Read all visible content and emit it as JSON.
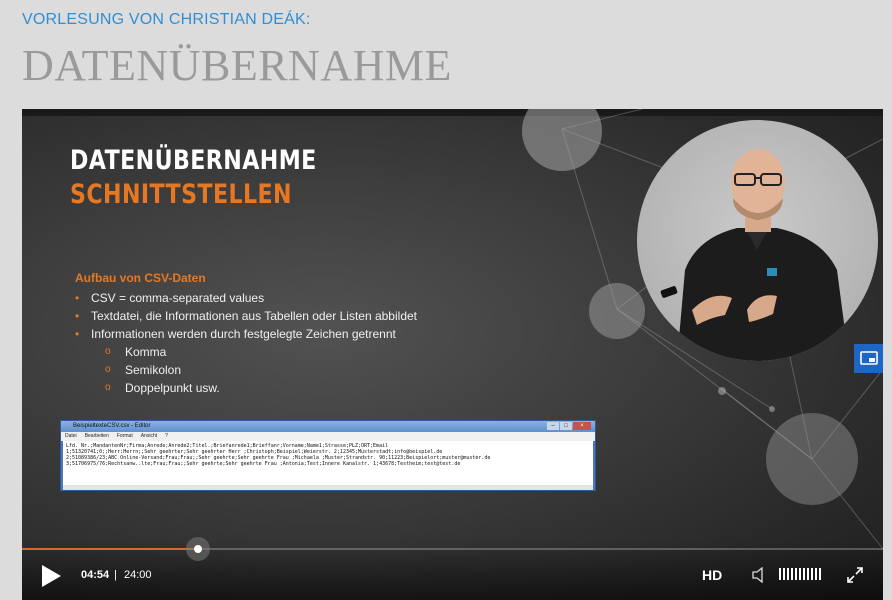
{
  "header": {
    "lecture_label": "VORLESUNG VON CHRISTIAN DEÁK:",
    "page_title": "DATENÜBERNAHME"
  },
  "slide": {
    "title": "DATENÜBERNAHME",
    "subtitle": "SCHNITTSTELLEN",
    "heading": "Aufbau von CSV-Daten",
    "bullets": [
      "CSV = comma-separated values",
      "Textdatei, die Informationen aus Tabellen oder Listen abbildet",
      "Informationen werden durch festgelegte Zeichen getrennt"
    ],
    "sub_bullets": [
      "Komma",
      "Semikolon",
      "Doppelpunkt usw."
    ],
    "bullet_marker": "•",
    "sub_bullet_marker": "o",
    "editor": {
      "title": "BeispieltexteCSV.csv - Editor",
      "menu": [
        "Datei",
        "Bearbeiten",
        "Format",
        "Ansicht",
        "?"
      ],
      "lines": [
        "Lfd. Nr.;MandantenNr;Firma;Anrede;Anrede2;Titel.;Briefanrede1;Brieffanr;Vorname;Name1;Strasse;PLZ;ORT;Email",
        "1;51320741;0;;Herr;Herrn;;Sehr geehrter;Sehr geehrter Herr ;Christoph;Beispiel;Weierstr. 2;12345;Musterstadt;info@beispiel.de",
        "2;51089386/23;ABC Online-Versand;Frau;Frau;;Sehr geehrte;Sehr geehrte Frau ;Michaela ;Muster;Strandstr. 90;11223;Beispielort;muster@muster.de",
        "3;51706975/76;Rechtsanw..lte;Frau;Frau;;Sehr geehrte;Sehr geehrte Frau ;Antonia;Test;Innere Kanalstr. 1;43678;Testheim;test@test.de"
      ]
    },
    "colors": {
      "accent_orange": "#e87722",
      "accent_blue": "#1e66c4"
    }
  },
  "player": {
    "current_time": "04:54",
    "separator": "|",
    "total_time": "24:00",
    "progress": 0.204,
    "hd_label": "HD",
    "icons": [
      "play-icon",
      "volume-icon",
      "volume-level-icon",
      "fullscreen-icon",
      "cast-icon"
    ]
  }
}
